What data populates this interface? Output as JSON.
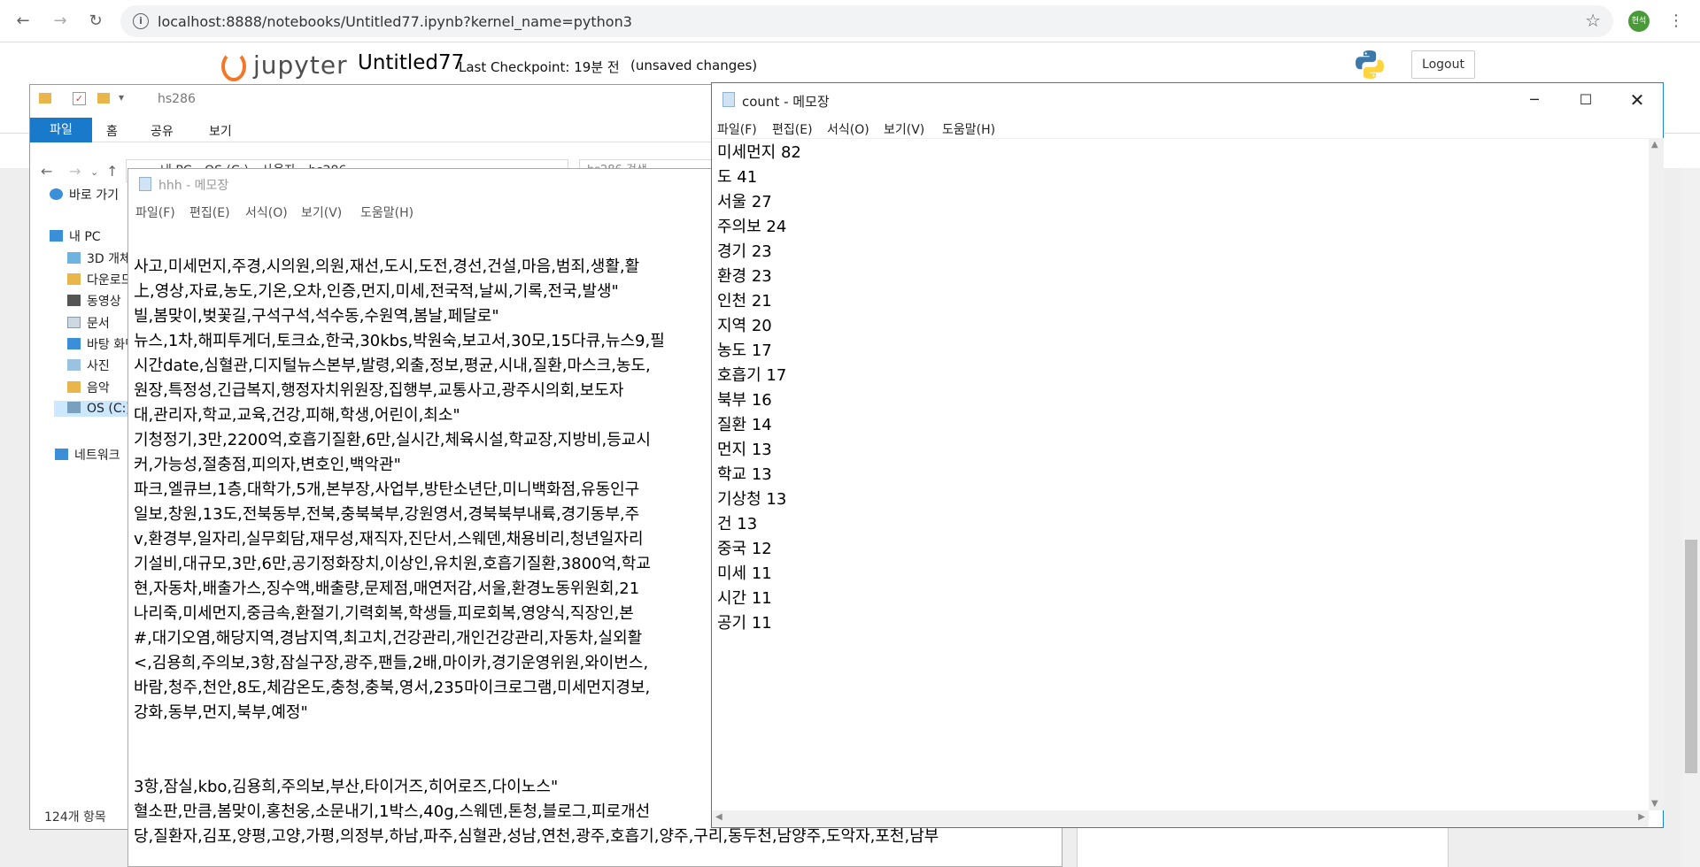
{
  "browser": {
    "url": "localhost:8888/notebooks/Untitled77.ipynb?kernel_name=python3",
    "profile_initials": "현석"
  },
  "jupyter": {
    "logo_text": "jupyter",
    "notebook_name": "Untitled77",
    "checkpoint": "Last Checkpoint: 19분 전",
    "unsaved": "(unsaved changes)",
    "logout": "Logout"
  },
  "explorer": {
    "title": "hs286",
    "ribbon": {
      "file": "파일",
      "home": "홈",
      "share": "공유",
      "view": "보기"
    },
    "address": [
      "내 PC",
      "OS (C:)",
      "사용자",
      "hs286"
    ],
    "search_placeholder": "hs286 검색",
    "sidebar": [
      {
        "label": "바로 가기",
        "icon": "star-icon",
        "color": "#3b8fd9"
      },
      {
        "label": "내 PC",
        "icon": "computer-icon",
        "color": "#3b8fd9"
      },
      {
        "label": "3D 개체",
        "icon": "folder-3d-icon",
        "color": "#6fb3e0"
      },
      {
        "label": "다운로드",
        "icon": "download-folder-icon",
        "color": "#e8b64a"
      },
      {
        "label": "동영상",
        "icon": "video-folder-icon",
        "color": "#e8b64a"
      },
      {
        "label": "문서",
        "icon": "document-folder-icon",
        "color": "#e8b64a"
      },
      {
        "label": "바탕 화면",
        "icon": "desktop-folder-icon",
        "color": "#3b8fd9"
      },
      {
        "label": "사진",
        "icon": "pictures-folder-icon",
        "color": "#e8b64a"
      },
      {
        "label": "음악",
        "icon": "music-folder-icon",
        "color": "#e8b64a"
      },
      {
        "label": "OS (C:)",
        "icon": "drive-icon",
        "color": "#7a9fbf"
      },
      {
        "label": "네트워크",
        "icon": "network-icon",
        "color": "#3b8fd9"
      }
    ],
    "status": "124개 항목"
  },
  "hhh_notepad": {
    "title": "hhh - 메모장",
    "menu": [
      "파일(F)",
      "편집(E)",
      "서식(O)",
      "보기(V)",
      "도움말(H)"
    ],
    "lines": [
      "사고,미세먼지,주경,시의원,의원,재선,도시,도전,경선,건설,마음,범죄,생활,활",
      "上,영상,자료,농도,기온,오차,인증,먼지,미세,전국적,날씨,기록,전국,발생\"",
      "빌,봄맞이,벚꽃길,구석구석,석수동,수원역,봄날,페달로\"",
      "뉴스,1차,해피투게더,토크쇼,한국,30kbs,박원숙,보고서,30모,15다큐,뉴스9,필",
      "시간date,심혈관,디지털뉴스본부,발령,외출,정보,평균,시내,질환,마스크,농도,",
      "원장,특정성,긴급복지,행정자치위원장,집행부,교통사고,광주시의회,보도자",
      "대,관리자,학교,교육,건강,피해,학생,어린이,최소\"",
      "기청정기,3만,2200억,호흡기질환,6만,실시간,체육시설,학교장,지방비,등교시",
      "커,가능성,절충점,피의자,변호인,백악관\"",
      "파크,엘큐브,1층,대학가,5개,본부장,사업부,방탄소년단,미니백화점,유동인구",
      "일보,창원,13도,전북동부,전북,충북북부,강원영서,경북북부내륙,경기동부,주",
      "v,환경부,일자리,실무회담,재무성,재직자,진단서,스웨덴,채용비리,청년일자리",
      "기설비,대규모,3만,6만,공기정화장치,이상인,유치원,호흡기질환,3800억,학교",
      "현,자동차,배출가스,징수액,배출량,문제점,매연저감,서울,환경노동위원회,21",
      "나리죽,미세먼지,중금속,환절기,기력회복,학생들,피로회복,영양식,직장인,본",
      "#,대기오염,해당지역,경남지역,최고치,건강관리,개인건강관리,자동차,실외활",
      "<,김용희,주의보,3항,잠실구장,광주,팬들,2배,마이카,경기운영위원,와이번스,",
      "바람,청주,천안,8도,체감온도,충청,충북,영서,235마이크로그램,미세먼지경보,",
      "강화,동부,먼지,북부,예정\"",
      "",
      "",
      "3항,잠실,kbo,김용희,주의보,부산,타이거즈,히어로즈,다이노스\"",
      "혈소판,만큼,봄맞이,홍천웅,소문내기,1박스,40g,스웨덴,톤청,블로그,피로개선",
      "당,질환자,김포,양평,고양,가평,의정부,하남,파주,심혈관,성남,연천,광주,호흡기,양주,구리,동두천,남양주,도악자,포천,남부"
    ]
  },
  "count_notepad": {
    "title": "count - 메모장",
    "menu": [
      "파일(F)",
      "편집(E)",
      "서식(O)",
      "보기(V)",
      "도움말(H)"
    ],
    "lines": [
      "미세먼지 82",
      "도 41",
      "서울 27",
      "주의보 24",
      "경기 23",
      "환경 23",
      "인천 21",
      "지역 20",
      "농도 17",
      "호흡기 17",
      "북부 16",
      "질환 14",
      "먼지 13",
      "학교 13",
      "기상청 13",
      "건 13",
      "중국 12",
      "미세 11",
      "시간 11",
      "공기 11"
    ]
  }
}
